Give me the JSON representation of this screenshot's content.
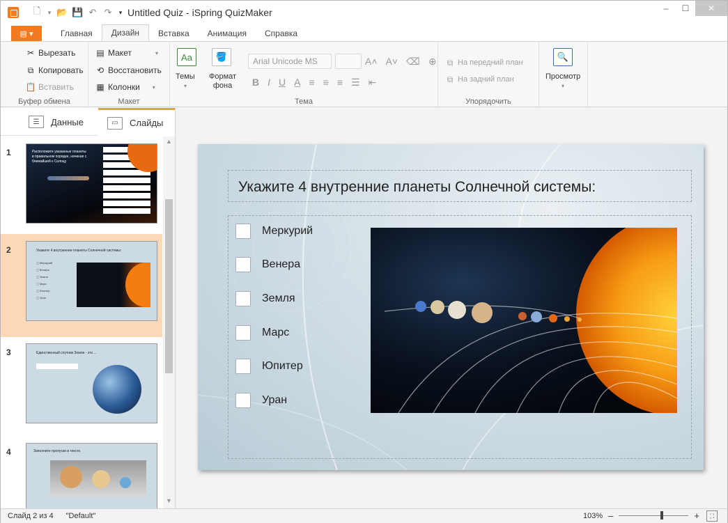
{
  "window": {
    "title": "Untitled Quiz - iSpring QuizMaker",
    "minimize": "–",
    "maximize": "☐",
    "close": "✕"
  },
  "quick_access": {
    "new": "🗋",
    "new_dd": "▾",
    "open": "📂",
    "save": "💾",
    "undo": "↶",
    "redo": "↷",
    "customize": "▾"
  },
  "ribbon_tabs": [
    {
      "label": "Главная"
    },
    {
      "label": "Дизайн"
    },
    {
      "label": "Вставка"
    },
    {
      "label": "Анимация"
    },
    {
      "label": "Справка"
    }
  ],
  "file_tab": "▤ ▾",
  "ribbon": {
    "clipboard": {
      "cut": "Вырезать",
      "copy": "Копировать",
      "paste": "Вставить",
      "label": "Буфер обмена"
    },
    "layout": {
      "layout": "Макет",
      "restore": "Восстановить",
      "columns": "Колонки",
      "label": "Макет"
    },
    "theme": {
      "themes": "Темы",
      "themes_icon": "Aa",
      "bg_format_1": "Формат",
      "bg_format_2": "фона",
      "font_name": "Arial Unicode MS",
      "label": "Тема"
    },
    "arrange": {
      "bring_front": "На передний план",
      "send_back": "На задний план",
      "label": "Упорядочить"
    },
    "preview": {
      "label": "Просмотр"
    }
  },
  "left_panel": {
    "tab_data": "Данные",
    "tab_slides": "Слайды",
    "slides": [
      {
        "num": "1",
        "title": "Расположите указанные планеты в правильном порядке, начиная с ближайшей к Солнцу"
      },
      {
        "num": "2",
        "title": "Укажите 4 внутренние планеты Солнечной системы:"
      },
      {
        "num": "3",
        "title": "Единственный спутник Земли - это ..."
      },
      {
        "num": "4",
        "title": "Заполните пропуски в тексте."
      }
    ]
  },
  "slide": {
    "title": "Укажите 4 внутренние планеты Солнечной системы:",
    "answers": [
      "Меркурий",
      "Венера",
      "Земля",
      "Марс",
      "Юпитер",
      "Уран"
    ]
  },
  "statusbar": {
    "slide_info": "Слайд 2 из 4",
    "theme": "\"Default\"",
    "zoom": "103%"
  },
  "colors": {
    "accent": "#f47a20",
    "selected_slide": "#fbd9b6"
  }
}
